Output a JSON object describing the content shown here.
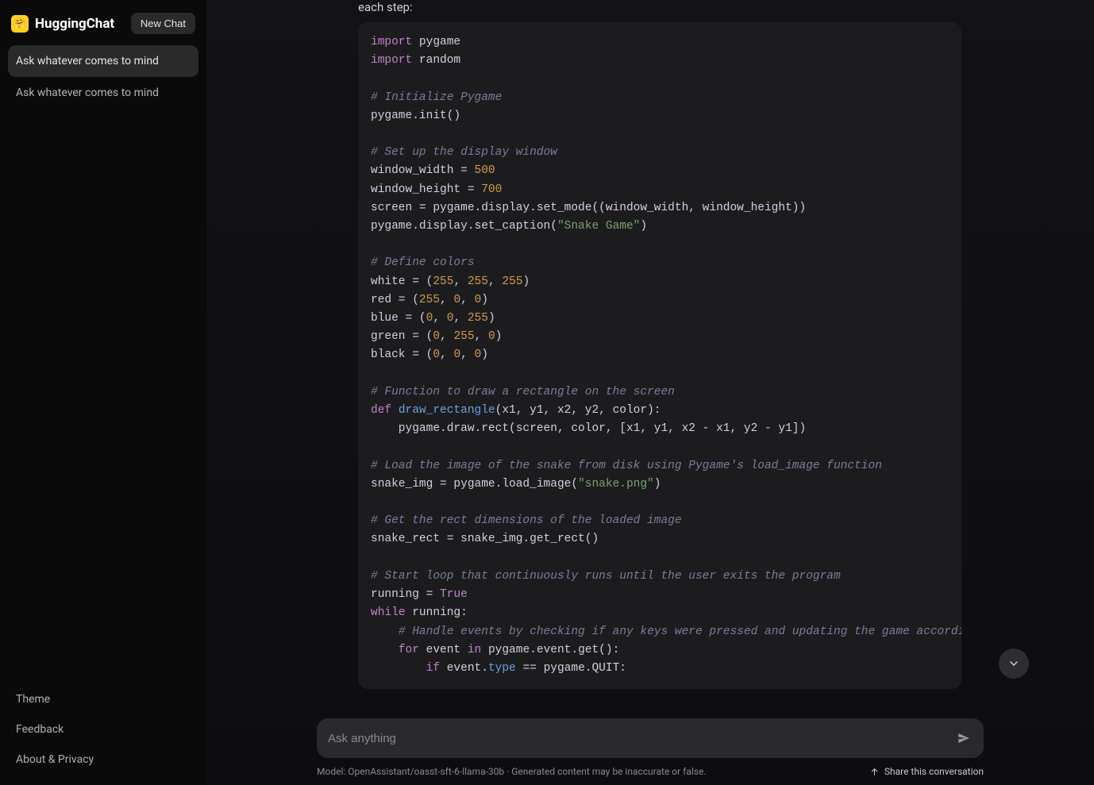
{
  "brand": {
    "name": "HuggingChat",
    "icon_glyph": "🤗"
  },
  "header": {
    "new_chat_label": "New Chat"
  },
  "sidebar": {
    "conversations": [
      {
        "label": "Ask whatever comes to mind",
        "active": true
      },
      {
        "label": "Ask whatever comes to mind",
        "active": false
      }
    ],
    "footer": [
      {
        "label": "Theme"
      },
      {
        "label": "Feedback"
      },
      {
        "label": "About & Privacy"
      }
    ]
  },
  "message": {
    "intro": "each step:",
    "code_lines": [
      {
        "segs": [
          {
            "t": "import",
            "c": "kw"
          },
          {
            "t": " pygame",
            "c": ""
          }
        ]
      },
      {
        "segs": [
          {
            "t": "import",
            "c": "kw"
          },
          {
            "t": " random",
            "c": ""
          }
        ]
      },
      {
        "segs": []
      },
      {
        "segs": [
          {
            "t": "# Initialize Pygame",
            "c": "com"
          }
        ]
      },
      {
        "segs": [
          {
            "t": "pygame.init()",
            "c": ""
          }
        ]
      },
      {
        "segs": []
      },
      {
        "segs": [
          {
            "t": "# Set up the display window",
            "c": "com"
          }
        ]
      },
      {
        "segs": [
          {
            "t": "window_width = ",
            "c": ""
          },
          {
            "t": "500",
            "c": "num"
          }
        ]
      },
      {
        "segs": [
          {
            "t": "window_height = ",
            "c": ""
          },
          {
            "t": "700",
            "c": "num"
          }
        ]
      },
      {
        "segs": [
          {
            "t": "screen = pygame.display.set_mode((window_width, window_height))",
            "c": ""
          }
        ]
      },
      {
        "segs": [
          {
            "t": "pygame.display.set_caption(",
            "c": ""
          },
          {
            "t": "\"Snake Game\"",
            "c": "str"
          },
          {
            "t": ")",
            "c": ""
          }
        ]
      },
      {
        "segs": []
      },
      {
        "segs": [
          {
            "t": "# Define colors",
            "c": "com"
          }
        ]
      },
      {
        "segs": [
          {
            "t": "white = (",
            "c": ""
          },
          {
            "t": "255",
            "c": "num"
          },
          {
            "t": ", ",
            "c": ""
          },
          {
            "t": "255",
            "c": "num"
          },
          {
            "t": ", ",
            "c": ""
          },
          {
            "t": "255",
            "c": "num"
          },
          {
            "t": ")",
            "c": ""
          }
        ]
      },
      {
        "segs": [
          {
            "t": "red = (",
            "c": ""
          },
          {
            "t": "255",
            "c": "num"
          },
          {
            "t": ", ",
            "c": ""
          },
          {
            "t": "0",
            "c": "num"
          },
          {
            "t": ", ",
            "c": ""
          },
          {
            "t": "0",
            "c": "num"
          },
          {
            "t": ")",
            "c": ""
          }
        ]
      },
      {
        "segs": [
          {
            "t": "blue = (",
            "c": ""
          },
          {
            "t": "0",
            "c": "num"
          },
          {
            "t": ", ",
            "c": ""
          },
          {
            "t": "0",
            "c": "num"
          },
          {
            "t": ", ",
            "c": ""
          },
          {
            "t": "255",
            "c": "num"
          },
          {
            "t": ")",
            "c": ""
          }
        ]
      },
      {
        "segs": [
          {
            "t": "green = (",
            "c": ""
          },
          {
            "t": "0",
            "c": "num"
          },
          {
            "t": ", ",
            "c": ""
          },
          {
            "t": "255",
            "c": "num"
          },
          {
            "t": ", ",
            "c": ""
          },
          {
            "t": "0",
            "c": "num"
          },
          {
            "t": ")",
            "c": ""
          }
        ]
      },
      {
        "segs": [
          {
            "t": "black = (",
            "c": ""
          },
          {
            "t": "0",
            "c": "num"
          },
          {
            "t": ", ",
            "c": ""
          },
          {
            "t": "0",
            "c": "num"
          },
          {
            "t": ", ",
            "c": ""
          },
          {
            "t": "0",
            "c": "num"
          },
          {
            "t": ")",
            "c": ""
          }
        ]
      },
      {
        "segs": []
      },
      {
        "segs": [
          {
            "t": "# Function to draw a rectangle on the screen",
            "c": "com"
          }
        ]
      },
      {
        "segs": [
          {
            "t": "def",
            "c": "kw"
          },
          {
            "t": " ",
            "c": ""
          },
          {
            "t": "draw_rectangle",
            "c": "fn"
          },
          {
            "t": "(x1, y1, x2, y2, color):",
            "c": ""
          }
        ]
      },
      {
        "segs": [
          {
            "t": "    pygame.draw.rect(screen, color, [x1, y1, x2 - x1, y2 - y1])",
            "c": ""
          }
        ]
      },
      {
        "segs": []
      },
      {
        "segs": [
          {
            "t": "# Load the image of the snake from disk using Pygame's load_image function",
            "c": "com"
          }
        ]
      },
      {
        "segs": [
          {
            "t": "snake_img = pygame.load_image(",
            "c": ""
          },
          {
            "t": "\"snake.png\"",
            "c": "str"
          },
          {
            "t": ")",
            "c": ""
          }
        ]
      },
      {
        "segs": []
      },
      {
        "segs": [
          {
            "t": "# Get the rect dimensions of the loaded image",
            "c": "com"
          }
        ]
      },
      {
        "segs": [
          {
            "t": "snake_rect = snake_img.get_rect()",
            "c": ""
          }
        ]
      },
      {
        "segs": []
      },
      {
        "segs": [
          {
            "t": "# Start loop that continuously runs until the user exits the program",
            "c": "com"
          }
        ]
      },
      {
        "segs": [
          {
            "t": "running = ",
            "c": ""
          },
          {
            "t": "True",
            "c": "bool"
          }
        ]
      },
      {
        "segs": [
          {
            "t": "while",
            "c": "kw"
          },
          {
            "t": " running:",
            "c": ""
          }
        ]
      },
      {
        "segs": [
          {
            "t": "    ",
            "c": ""
          },
          {
            "t": "# Handle events by checking if any keys were pressed and updating the game accordingly",
            "c": "com"
          }
        ]
      },
      {
        "segs": [
          {
            "t": "    ",
            "c": ""
          },
          {
            "t": "for",
            "c": "kw"
          },
          {
            "t": " event ",
            "c": ""
          },
          {
            "t": "in",
            "c": "kw"
          },
          {
            "t": " pygame.event.get():",
            "c": ""
          }
        ]
      },
      {
        "segs": [
          {
            "t": "        ",
            "c": ""
          },
          {
            "t": "if",
            "c": "kw"
          },
          {
            "t": " event.",
            "c": ""
          },
          {
            "t": "type",
            "c": "type"
          },
          {
            "t": " == pygame.QUIT:",
            "c": ""
          }
        ]
      }
    ]
  },
  "input": {
    "placeholder": "Ask anything"
  },
  "meta": {
    "model_line": "Model: OpenAssistant/oasst-sft-6-llama-30b · Generated content may be inaccurate or false.",
    "share_label": "Share this conversation"
  }
}
